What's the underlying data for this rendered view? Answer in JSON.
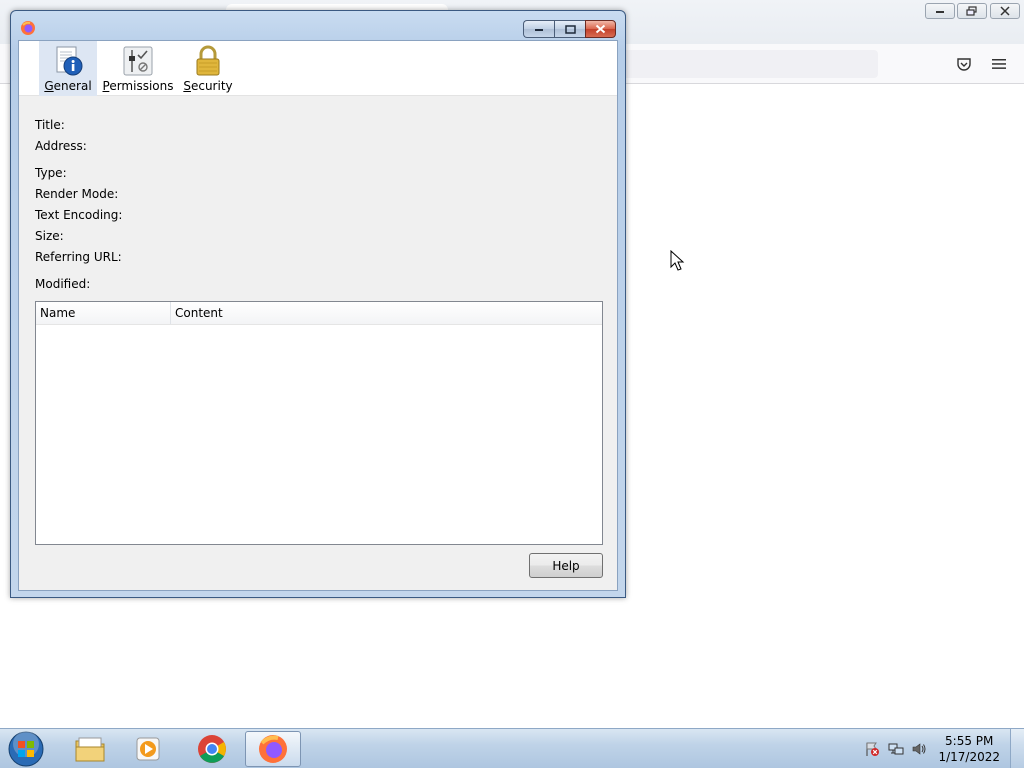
{
  "dialog": {
    "tabs": [
      {
        "label": "General",
        "accel": "G",
        "rest": "eneral",
        "icon": "info-document-icon",
        "selected": true
      },
      {
        "label": "Permissions",
        "accel": "P",
        "rest": "ermissions",
        "icon": "permissions-icon",
        "selected": false
      },
      {
        "label": "Security",
        "accel": "S",
        "rest": "ecurity",
        "icon": "padlock-icon",
        "selected": false
      }
    ],
    "fields": {
      "title": "Title:",
      "address": "Address:",
      "type": "Type:",
      "render_mode": "Render Mode:",
      "text_encoding": "Text Encoding:",
      "size": "Size:",
      "referring_url": "Referring URL:",
      "modified": "Modified:"
    },
    "meta_table": {
      "columns": [
        "Name",
        "Content"
      ],
      "rows": []
    },
    "help_label": "Help"
  },
  "taskbar": {
    "items": [
      "start-orb",
      "file-explorer",
      "media-player",
      "chrome",
      "firefox"
    ],
    "active_item": "firefox",
    "clock_time": "5:55 PM",
    "clock_date": "1/17/2022"
  }
}
